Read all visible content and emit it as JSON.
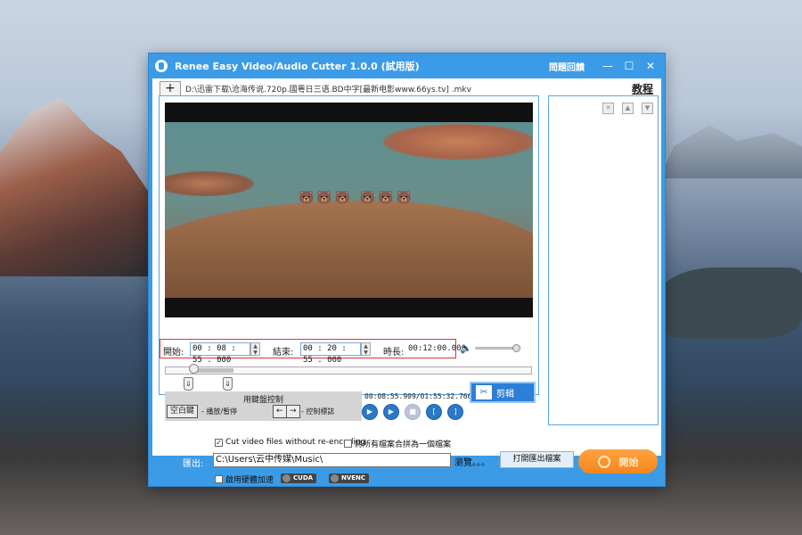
{
  "window": {
    "title": "Renee Easy Video/Audio Cutter 1.0.0 (試用版)",
    "help_label": "問題回饋",
    "minimize": "—",
    "maximize": "☐",
    "close": "✕"
  },
  "toolbar": {
    "add_label": "+",
    "file_path": "D:\\迅雷下载\\沧海传说.720p.國粵日三语.BD中字[最新电影www.66ys.tv] .mkv",
    "tutorial_label": "教程"
  },
  "player": {
    "animals": "🐻🐻🐻 🐻🐻🐻"
  },
  "trim": {
    "start_label": "開始:",
    "start_value": "00 : 08 : 55 . 000",
    "end_label": "結束:",
    "end_value": "00 : 20 : 55 . 000",
    "duration_label": "時長:",
    "duration_value": "00:12:00.000",
    "spin_up": "▲",
    "spin_down": "▼"
  },
  "volume": {
    "icon": "🔈",
    "level": 1.0
  },
  "timeline": {
    "left_marker": "⇓",
    "right_marker": "⇓",
    "selection_start_fraction": 0.076,
    "selection_end_fraction": 0.183
  },
  "keyboard": {
    "title": "用鍵盤控制",
    "space_key": "空白鍵",
    "space_desc": "- 播放/暫停",
    "arrow_left": "←",
    "arrow_right": "→",
    "arrow_desc": "- 控制標誌"
  },
  "playback": {
    "time": "00:08:55.909/01:55:32.766",
    "play": "▶",
    "play_segment": "▶",
    "stop": "■",
    "mark_start": "[",
    "mark_end": "]"
  },
  "cut_button": {
    "icon": "✂",
    "label": "剪輯"
  },
  "list_panel": {
    "delete": "✕",
    "up": "▲",
    "down": "▼"
  },
  "options": {
    "no_reencode": "Cut video files without re-encoding",
    "no_reencode_checked": "✓",
    "merge": "將所有檔案合拼為一個檔案",
    "merge_checked": "",
    "hw_accel": "啟用硬體加速",
    "hw_accel_checked": "",
    "cuda": "CUDA",
    "nvenc": "NVENC"
  },
  "export": {
    "label": "匯出:",
    "path": "C:\\Users\\云中传媒\\Music\\",
    "browse": "瀏覽。。。",
    "open_folder": "打開匯出檔案",
    "start": "開始"
  }
}
